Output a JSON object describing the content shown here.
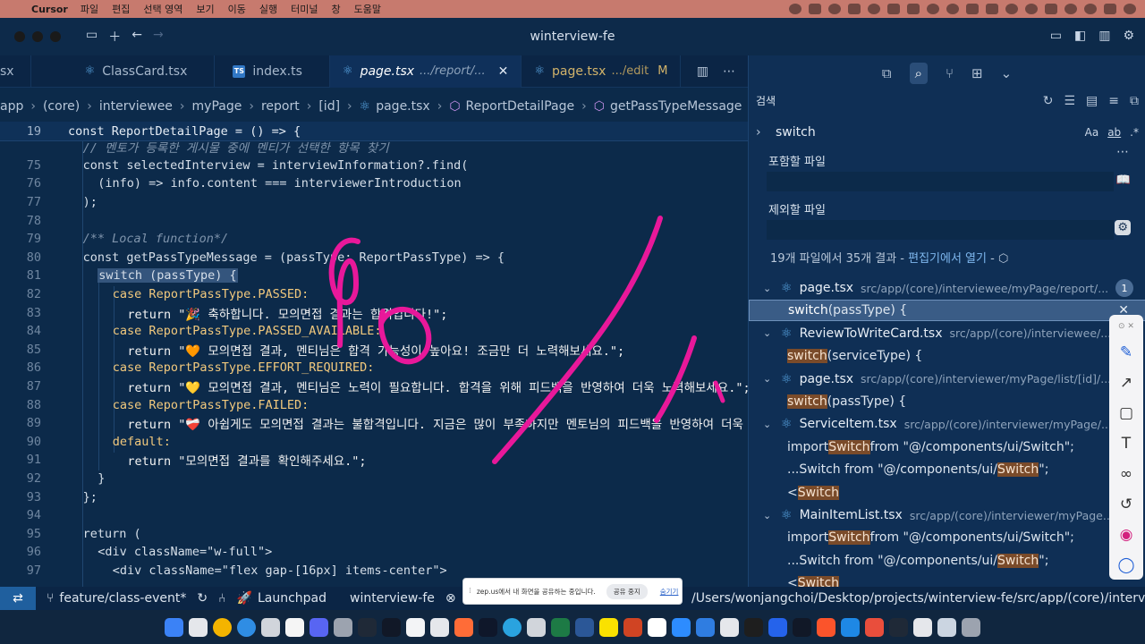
{
  "menubar": {
    "app_name": "Cursor",
    "items": [
      "파일",
      "편집",
      "선택 영역",
      "보기",
      "이동",
      "실행",
      "터미널",
      "창",
      "도움말"
    ]
  },
  "window": {
    "title": "winterview-fe"
  },
  "tabs": [
    {
      "label": "ClassCard.tsx",
      "icon": "react-icon"
    },
    {
      "label": "index.ts",
      "icon": "ts-icon"
    },
    {
      "label": "page.tsx",
      "path": ".../report/...",
      "icon": "react-icon",
      "active": true
    },
    {
      "label": "page.tsx",
      "path": ".../edit",
      "modified": "M",
      "icon": "react-icon"
    }
  ],
  "tab_first_fragment": "sx",
  "breadcrumb": [
    "app",
    "(core)",
    "interviewee",
    "myPage",
    "report",
    "[id]",
    "page.tsx",
    "ReportDetailPage",
    "getPassTypeMessage"
  ],
  "editor": {
    "sticky_line": {
      "num": "19",
      "text": "const ReportDetailPage = () => {"
    },
    "lines": [
      {
        "num": "",
        "text": "// 멘토가 등록한 게시물 중에 멘티가 선택한 항목 찾기"
      },
      {
        "num": "75",
        "text": "const selectedInterview = interviewInformation?.find("
      },
      {
        "num": "76",
        "text": "(info) => info.content === interviewerIntroduction"
      },
      {
        "num": "77",
        "text": ");"
      },
      {
        "num": "78",
        "text": ""
      },
      {
        "num": "79",
        "text": "/** Local function*/"
      },
      {
        "num": "80",
        "text": "const getPassTypeMessage = (passType: ReportPassType) => {"
      },
      {
        "num": "81",
        "text": "switch (passType) {"
      },
      {
        "num": "82",
        "text": "case ReportPassType.PASSED:"
      },
      {
        "num": "83",
        "text": "return \"🎉 축하합니다. 모의면접 결과는 합격입니다!\";"
      },
      {
        "num": "84",
        "text": "case ReportPassType.PASSED_AVAILABLE:"
      },
      {
        "num": "85",
        "text": "return \"🧡 모의면접 결과, 멘티님은 합격 가능성이 높아요! 조금만 더 노력해보세요.\";"
      },
      {
        "num": "86",
        "text": "case ReportPassType.EFFORT_REQUIRED:"
      },
      {
        "num": "87",
        "text": "return \"💛 모의면접 결과, 멘티님은 노력이 필요합니다. 합격을 위해 피드백을 반영하여 더욱 노력해보세요.\";"
      },
      {
        "num": "88",
        "text": "case ReportPassType.FAILED:"
      },
      {
        "num": "89",
        "text": "return \"❤️‍🩹 아쉽게도 모의면접 결과는 불합격입니다. 지금은 많이 부족하지만 멘토님의 피드백을 반영하여 더욱 노력"
      },
      {
        "num": "90",
        "text": "default:"
      },
      {
        "num": "91",
        "text": "return \"모의면접 결과를 확인해주세요.\";"
      },
      {
        "num": "92",
        "text": "}"
      },
      {
        "num": "93",
        "text": "};"
      },
      {
        "num": "94",
        "text": ""
      },
      {
        "num": "95",
        "text": "return ("
      },
      {
        "num": "96",
        "text": "<div className=\"w-full\">"
      },
      {
        "num": "97",
        "text": "<div className=\"flex gap-[16px] items-center\">"
      }
    ]
  },
  "sidebar": {
    "title": "검색",
    "search_value": "switch",
    "search_opts": [
      "Aa",
      "ab",
      ".*"
    ],
    "include_label": "포함할 파일",
    "exclude_label": "제외할 파일",
    "summary_prefix": "19개 파일에서 35개 결과 - ",
    "summary_link": "편집기에서 열기",
    "summary_suffix": " -",
    "results": [
      {
        "kind": "file",
        "name": "page.tsx",
        "path": "src/app/(core)/interviewee/myPage/report/...",
        "badge": "1"
      },
      {
        "kind": "match",
        "before": "",
        "hl": "switch",
        "after": " (passType) {",
        "selected": true
      },
      {
        "kind": "file",
        "name": "ReviewToWriteCard.tsx",
        "path": "src/app/(core)/interviewee/..."
      },
      {
        "kind": "match",
        "before": "",
        "hl": "switch",
        "after": " (serviceType) {"
      },
      {
        "kind": "file",
        "name": "page.tsx",
        "path": "src/app/(core)/interviewer/myPage/list/[id]/..."
      },
      {
        "kind": "match",
        "before": "",
        "hl": "switch",
        "after": " (passType) {"
      },
      {
        "kind": "file",
        "name": "ServiceItem.tsx",
        "path": "src/app/(core)/interviewer/myPage/..."
      },
      {
        "kind": "match",
        "before": "import ",
        "hl": "Switch",
        "after": " from \"@/components/ui/Switch\";"
      },
      {
        "kind": "match",
        "before": "...Switch from \"@/components/ui/",
        "hl": "Switch",
        "after": "\";"
      },
      {
        "kind": "match",
        "before": "<",
        "hl": "Switch",
        "after": ""
      },
      {
        "kind": "file",
        "name": "MainItemList.tsx",
        "path": "src/app/(core)/interviewer/myPage..."
      },
      {
        "kind": "match",
        "before": "import ",
        "hl": "Switch",
        "after": " from \"@/components/ui/Switch\";"
      },
      {
        "kind": "match",
        "before": "...Switch from \"@/components/ui/",
        "hl": "Switch",
        "after": "\";"
      },
      {
        "kind": "match",
        "before": "<",
        "hl": "Switch",
        "after": ""
      }
    ]
  },
  "statusbar": {
    "branch": "feature/class-event*",
    "launchpad": "Launchpad",
    "project": "winterview-fe",
    "path": "/Users/wonjangchoi/Desktop/projects/winterview-fe/src/app/(core)/interviewe"
  },
  "share_notice": {
    "message": "zep.us에서 내 화면을 공유하는 중입니다.",
    "stop_label": "공유 중지",
    "hide_label": "숨기기"
  },
  "colors": {
    "editor_bg": "#0c2a4a",
    "ink": "#e8189a",
    "menubar_bg": "#c77a6e"
  }
}
